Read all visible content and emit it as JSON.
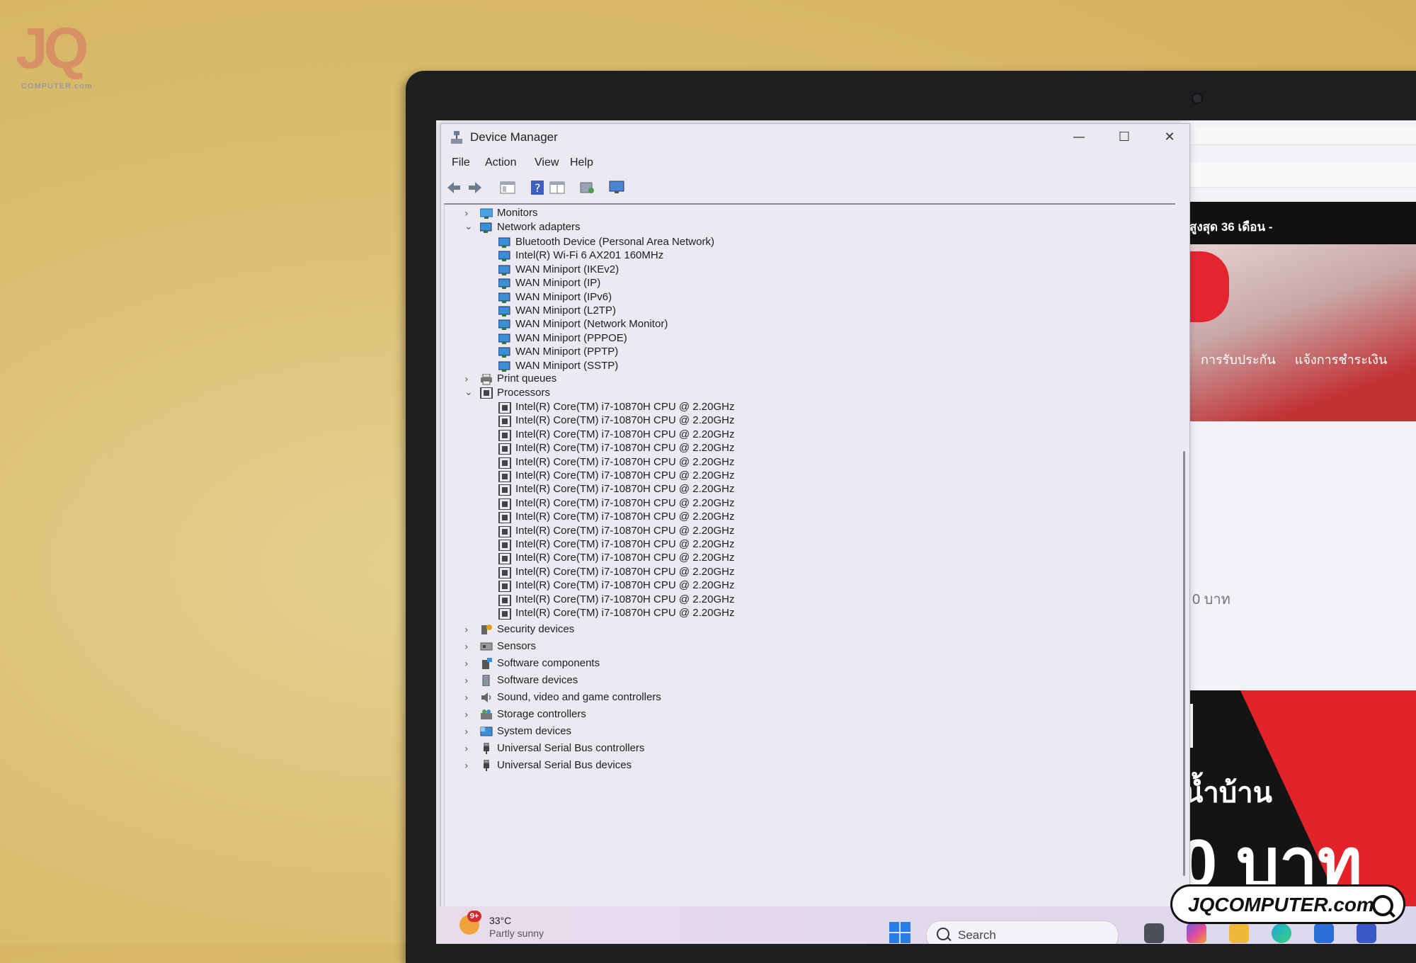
{
  "watermark": {
    "logo_letters": "JQ",
    "logo_sub": "COMPUTER.com",
    "badge": "JQCOMPUTER.com"
  },
  "background_browser": {
    "promo_bar": "สูงสุด 36 เดือน -",
    "nav_links": [
      "การรับประกัน",
      "แจ้งการชำระเงิน"
    ],
    "price_small": "0 บาท",
    "ad_line1": "I",
    "ad_line2": "น้ำบ้าน",
    "ad_line3": "0 บาท"
  },
  "window": {
    "title": "Device Manager",
    "controls": {
      "minimize": "—",
      "maximize": "☐",
      "close": "✕"
    },
    "menu": [
      "File",
      "Action",
      "View",
      "Help"
    ],
    "toolbar_icons": [
      "back-icon",
      "forward-icon",
      "properties-icon",
      "help-icon",
      "view-icon",
      "scan-hardware-icon",
      "monitor-icon"
    ]
  },
  "tree": {
    "categories": {
      "monitors": "Monitors",
      "network_adapters": "Network adapters",
      "print_queues": "Print queues",
      "processors": "Processors",
      "security_devices": "Security devices",
      "sensors": "Sensors",
      "software_components": "Software components",
      "software_devices": "Software devices",
      "sound": "Sound, video and game controllers",
      "storage": "Storage controllers",
      "system_devices": "System devices",
      "usb_controllers": "Universal Serial Bus controllers",
      "usb_devices": "Universal Serial Bus devices"
    },
    "network_adapters": [
      "Bluetooth Device (Personal Area Network)",
      "Intel(R) Wi-Fi 6 AX201 160MHz",
      "WAN Miniport (IKEv2)",
      "WAN Miniport (IP)",
      "WAN Miniport (IPv6)",
      "WAN Miniport (L2TP)",
      "WAN Miniport (Network Monitor)",
      "WAN Miniport (PPPOE)",
      "WAN Miniport (PPTP)",
      "WAN Miniport (SSTP)"
    ],
    "processors": [
      "Intel(R) Core(TM) i7-10870H CPU @ 2.20GHz",
      "Intel(R) Core(TM) i7-10870H CPU @ 2.20GHz",
      "Intel(R) Core(TM) i7-10870H CPU @ 2.20GHz",
      "Intel(R) Core(TM) i7-10870H CPU @ 2.20GHz",
      "Intel(R) Core(TM) i7-10870H CPU @ 2.20GHz",
      "Intel(R) Core(TM) i7-10870H CPU @ 2.20GHz",
      "Intel(R) Core(TM) i7-10870H CPU @ 2.20GHz",
      "Intel(R) Core(TM) i7-10870H CPU @ 2.20GHz",
      "Intel(R) Core(TM) i7-10870H CPU @ 2.20GHz",
      "Intel(R) Core(TM) i7-10870H CPU @ 2.20GHz",
      "Intel(R) Core(TM) i7-10870H CPU @ 2.20GHz",
      "Intel(R) Core(TM) i7-10870H CPU @ 2.20GHz",
      "Intel(R) Core(TM) i7-10870H CPU @ 2.20GHz",
      "Intel(R) Core(TM) i7-10870H CPU @ 2.20GHz",
      "Intel(R) Core(TM) i7-10870H CPU @ 2.20GHz",
      "Intel(R) Core(TM) i7-10870H CPU @ 2.20GHz"
    ],
    "collapsed_glyph": "›",
    "expanded_glyph": "⌄"
  },
  "taskbar": {
    "weather_badge": "9+",
    "temperature": "33°C",
    "condition": "Partly sunny",
    "search_placeholder": "Search"
  },
  "colors": {
    "accent": "#2b7de3",
    "network_icon": "#3a8fd6",
    "brand_red": "#e3232a"
  }
}
